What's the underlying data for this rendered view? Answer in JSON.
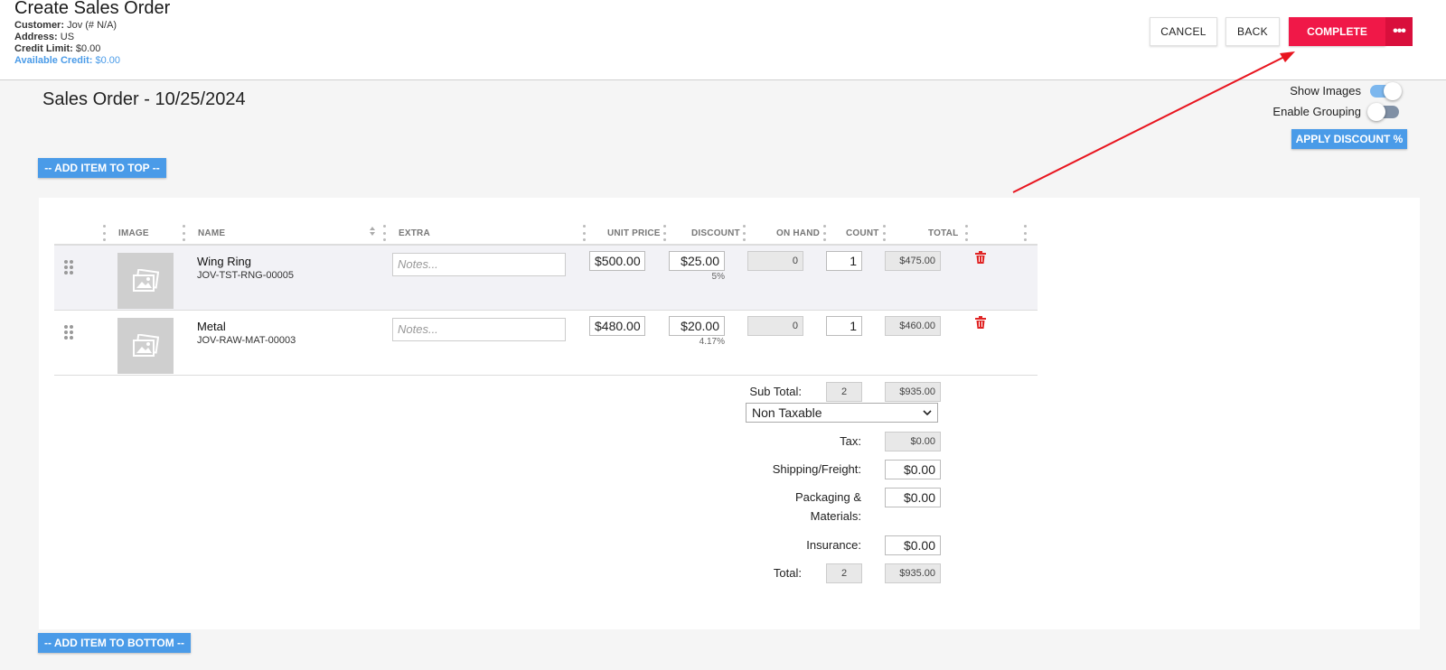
{
  "header": {
    "title": "Create Sales Order",
    "customer_label": "Customer:",
    "customer_value": "Jov (# N/A)",
    "address_label": "Address:",
    "address_value": "US",
    "credit_limit_label": "Credit Limit:",
    "credit_limit_value": "$0.00",
    "available_credit_label": "Available Credit:",
    "available_credit_value": "$0.00",
    "buttons": {
      "cancel": "CANCEL",
      "back": "BACK",
      "complete": "COMPLETE",
      "more": "•••"
    },
    "complete_color": "#f01848"
  },
  "order": {
    "title": "Sales Order - 10/25/2024",
    "show_images_label": "Show Images",
    "show_images": true,
    "enable_grouping_label": "Enable Grouping",
    "enable_grouping": false,
    "apply_discount_label": "APPLY DISCOUNT %",
    "add_top_label": "-- ADD ITEM TO TOP --",
    "add_bottom_label": "-- ADD ITEM TO BOTTOM --"
  },
  "table": {
    "columns": {
      "image": "IMAGE",
      "name": "NAME",
      "extra": "EXTRA",
      "unit_price": "UNIT PRICE",
      "discount": "DISCOUNT",
      "on_hand": "ON HAND",
      "count": "COUNT",
      "total": "TOTAL"
    },
    "notes_placeholder": "Notes...",
    "rows": [
      {
        "name": "Wing Ring",
        "sku": "JOV-TST-RNG-00005",
        "unit_price": "$500.00",
        "discount": "$25.00",
        "discount_pct": "5%",
        "on_hand": "0",
        "count": "1",
        "total": "$475.00"
      },
      {
        "name": "Metal",
        "sku": "JOV-RAW-MAT-00003",
        "unit_price": "$480.00",
        "discount": "$20.00",
        "discount_pct": "4.17%",
        "on_hand": "0",
        "count": "1",
        "total": "$460.00"
      }
    ]
  },
  "summary": {
    "subtotal_label": "Sub Total:",
    "subtotal_count": "2",
    "subtotal_value": "$935.00",
    "tax_option": "Non Taxable",
    "tax_label": "Tax:",
    "tax_value": "$0.00",
    "shipping_label": "Shipping/Freight:",
    "shipping_value": "$0.00",
    "packaging_label_1": "Packaging &",
    "packaging_label_2": "Materials:",
    "packaging_value": "$0.00",
    "insurance_label": "Insurance:",
    "insurance_value": "$0.00",
    "total_label": "Total:",
    "total_count": "2",
    "total_value": "$935.00"
  },
  "colors": {
    "accent_blue": "#4a9be8",
    "complete_red": "#f01848",
    "annotation_arrow": "#e8141e"
  }
}
